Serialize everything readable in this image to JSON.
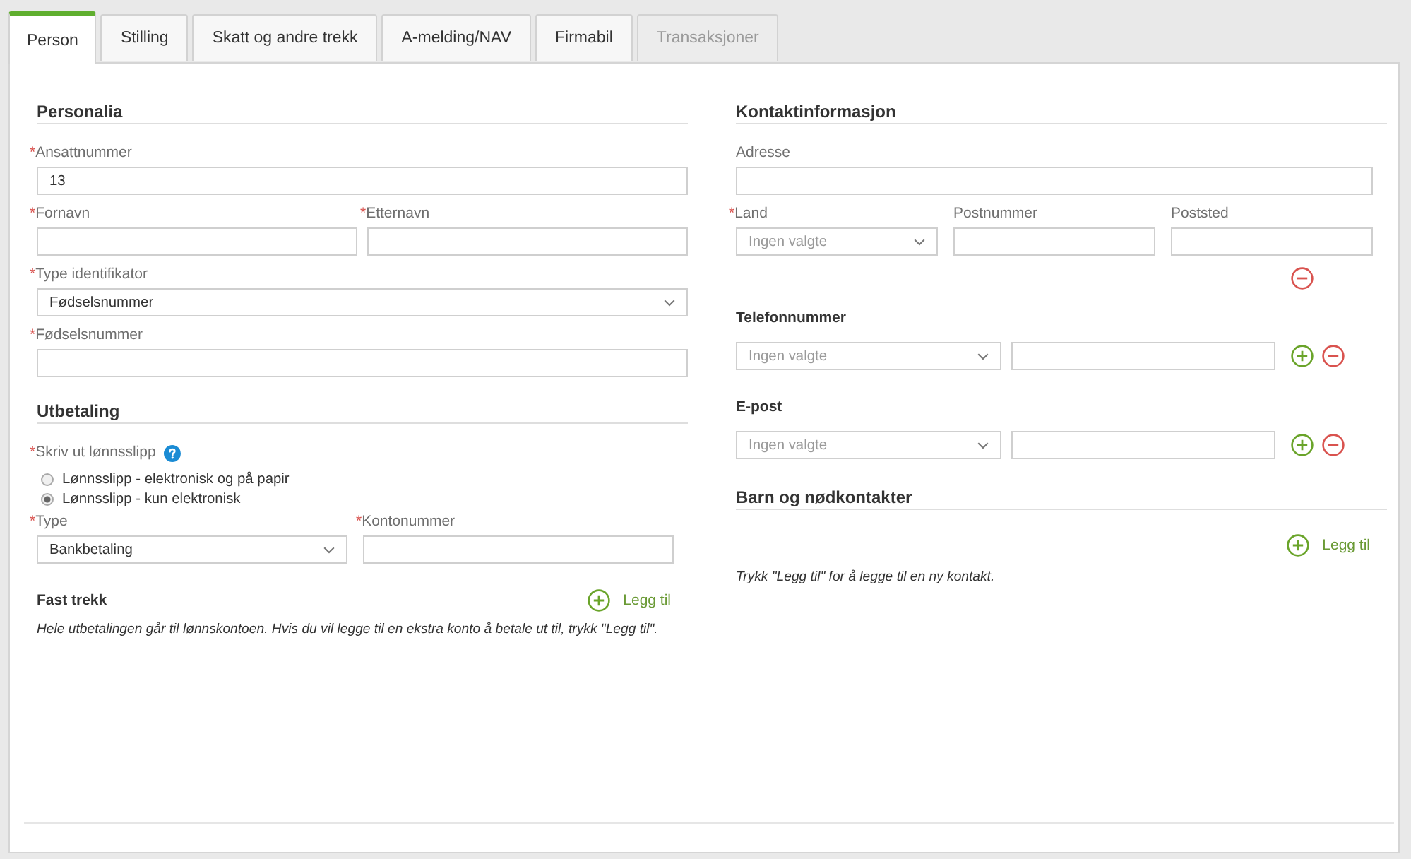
{
  "tabs": [
    {
      "label": "Person",
      "selected": true,
      "disabled": false
    },
    {
      "label": "Stilling",
      "selected": false,
      "disabled": false
    },
    {
      "label": "Skatt og andre trekk",
      "selected": false,
      "disabled": false
    },
    {
      "label": "A-melding/NAV",
      "selected": false,
      "disabled": false
    },
    {
      "label": "Firmabil",
      "selected": false,
      "disabled": false
    },
    {
      "label": "Transaksjoner",
      "selected": false,
      "disabled": true
    }
  ],
  "personalia": {
    "title": "Personalia",
    "rows": [
      [
        {
          "kind": "text",
          "mark": "*",
          "label": "Ansattnummer",
          "value": "13"
        }
      ],
      [
        {
          "kind": "text",
          "mark": "*",
          "label": "Fornavn"
        },
        {
          "kind": "text",
          "mark": "*",
          "label": "Etternavn"
        }
      ],
      [
        {
          "kind": "select",
          "mark": "*",
          "label": "Type identifikator",
          "value": "Fødselsnummer"
        }
      ],
      [
        {
          "kind": "text",
          "mark": "*",
          "label": "Fødselsnummer"
        }
      ]
    ]
  },
  "utbetaling": {
    "title": "Utbetaling",
    "payslip": {
      "mark": "*",
      "label": "Skriv ut lønnsslipp",
      "options": [
        {
          "label": "Lønnsslipp - elektronisk og på papir",
          "selected": false
        },
        {
          "label": "Lønnsslipp - kun elektronisk",
          "selected": true
        }
      ]
    },
    "rows": [
      [
        {
          "kind": "select",
          "mark": "*",
          "label": "Type",
          "value": "Bankbetaling"
        },
        {
          "kind": "text",
          "mark": "*",
          "label": "Kontonummer"
        }
      ]
    ],
    "fast_trekk": {
      "title": "Fast trekk",
      "add_label": "Legg til",
      "note": "Hele utbetalingen går til lønnskontoen. Hvis du vil legge til en ekstra konto å betale ut til, trykk \"Legg til\"."
    }
  },
  "kontakt": {
    "title": "Kontaktinformasjon",
    "rows": [
      [
        {
          "kind": "text",
          "label": "Adresse"
        }
      ],
      [
        {
          "kind": "select",
          "mark": "*",
          "label": "Land",
          "placeholder": "Ingen valgte"
        },
        {
          "kind": "text",
          "label": "Postnummer"
        },
        {
          "kind": "text",
          "label": "Poststed"
        }
      ]
    ],
    "groups": [
      {
        "title": "Telefonnummer",
        "type": {
          "placeholder": "Ingen valgte"
        }
      },
      {
        "title": "E-post",
        "type": {
          "placeholder": "Ingen valgte"
        }
      }
    ]
  },
  "barn": {
    "title": "Barn og nødkontakter",
    "add_label": "Legg til",
    "note": "Trykk \"Legg til\" for å legge til en ny kontakt."
  }
}
